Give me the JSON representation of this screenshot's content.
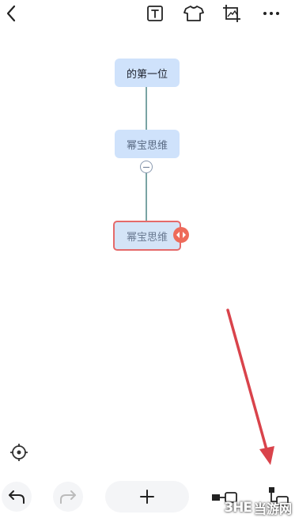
{
  "nodes": {
    "root": "的第一位",
    "child": "幂宝思维",
    "selected": "幂宝思维"
  },
  "watermark": {
    "brand": "3HE",
    "site": "当游网"
  },
  "icons": {
    "back": "chevron-left-icon",
    "text": "text-box-icon",
    "theme": "tshirt-icon",
    "image": "image-crop-icon",
    "more": "more-dots-icon",
    "locate": "crosshair-icon",
    "undo": "undo-icon",
    "redo": "redo-icon",
    "add": "plus-icon",
    "sibling": "add-sibling-icon",
    "child": "add-child-icon"
  },
  "colors": {
    "node_fill": "#cfe2fb",
    "selection": "#e56a6a",
    "connector": "#7aa4a4",
    "arrow": "#d9434b"
  }
}
